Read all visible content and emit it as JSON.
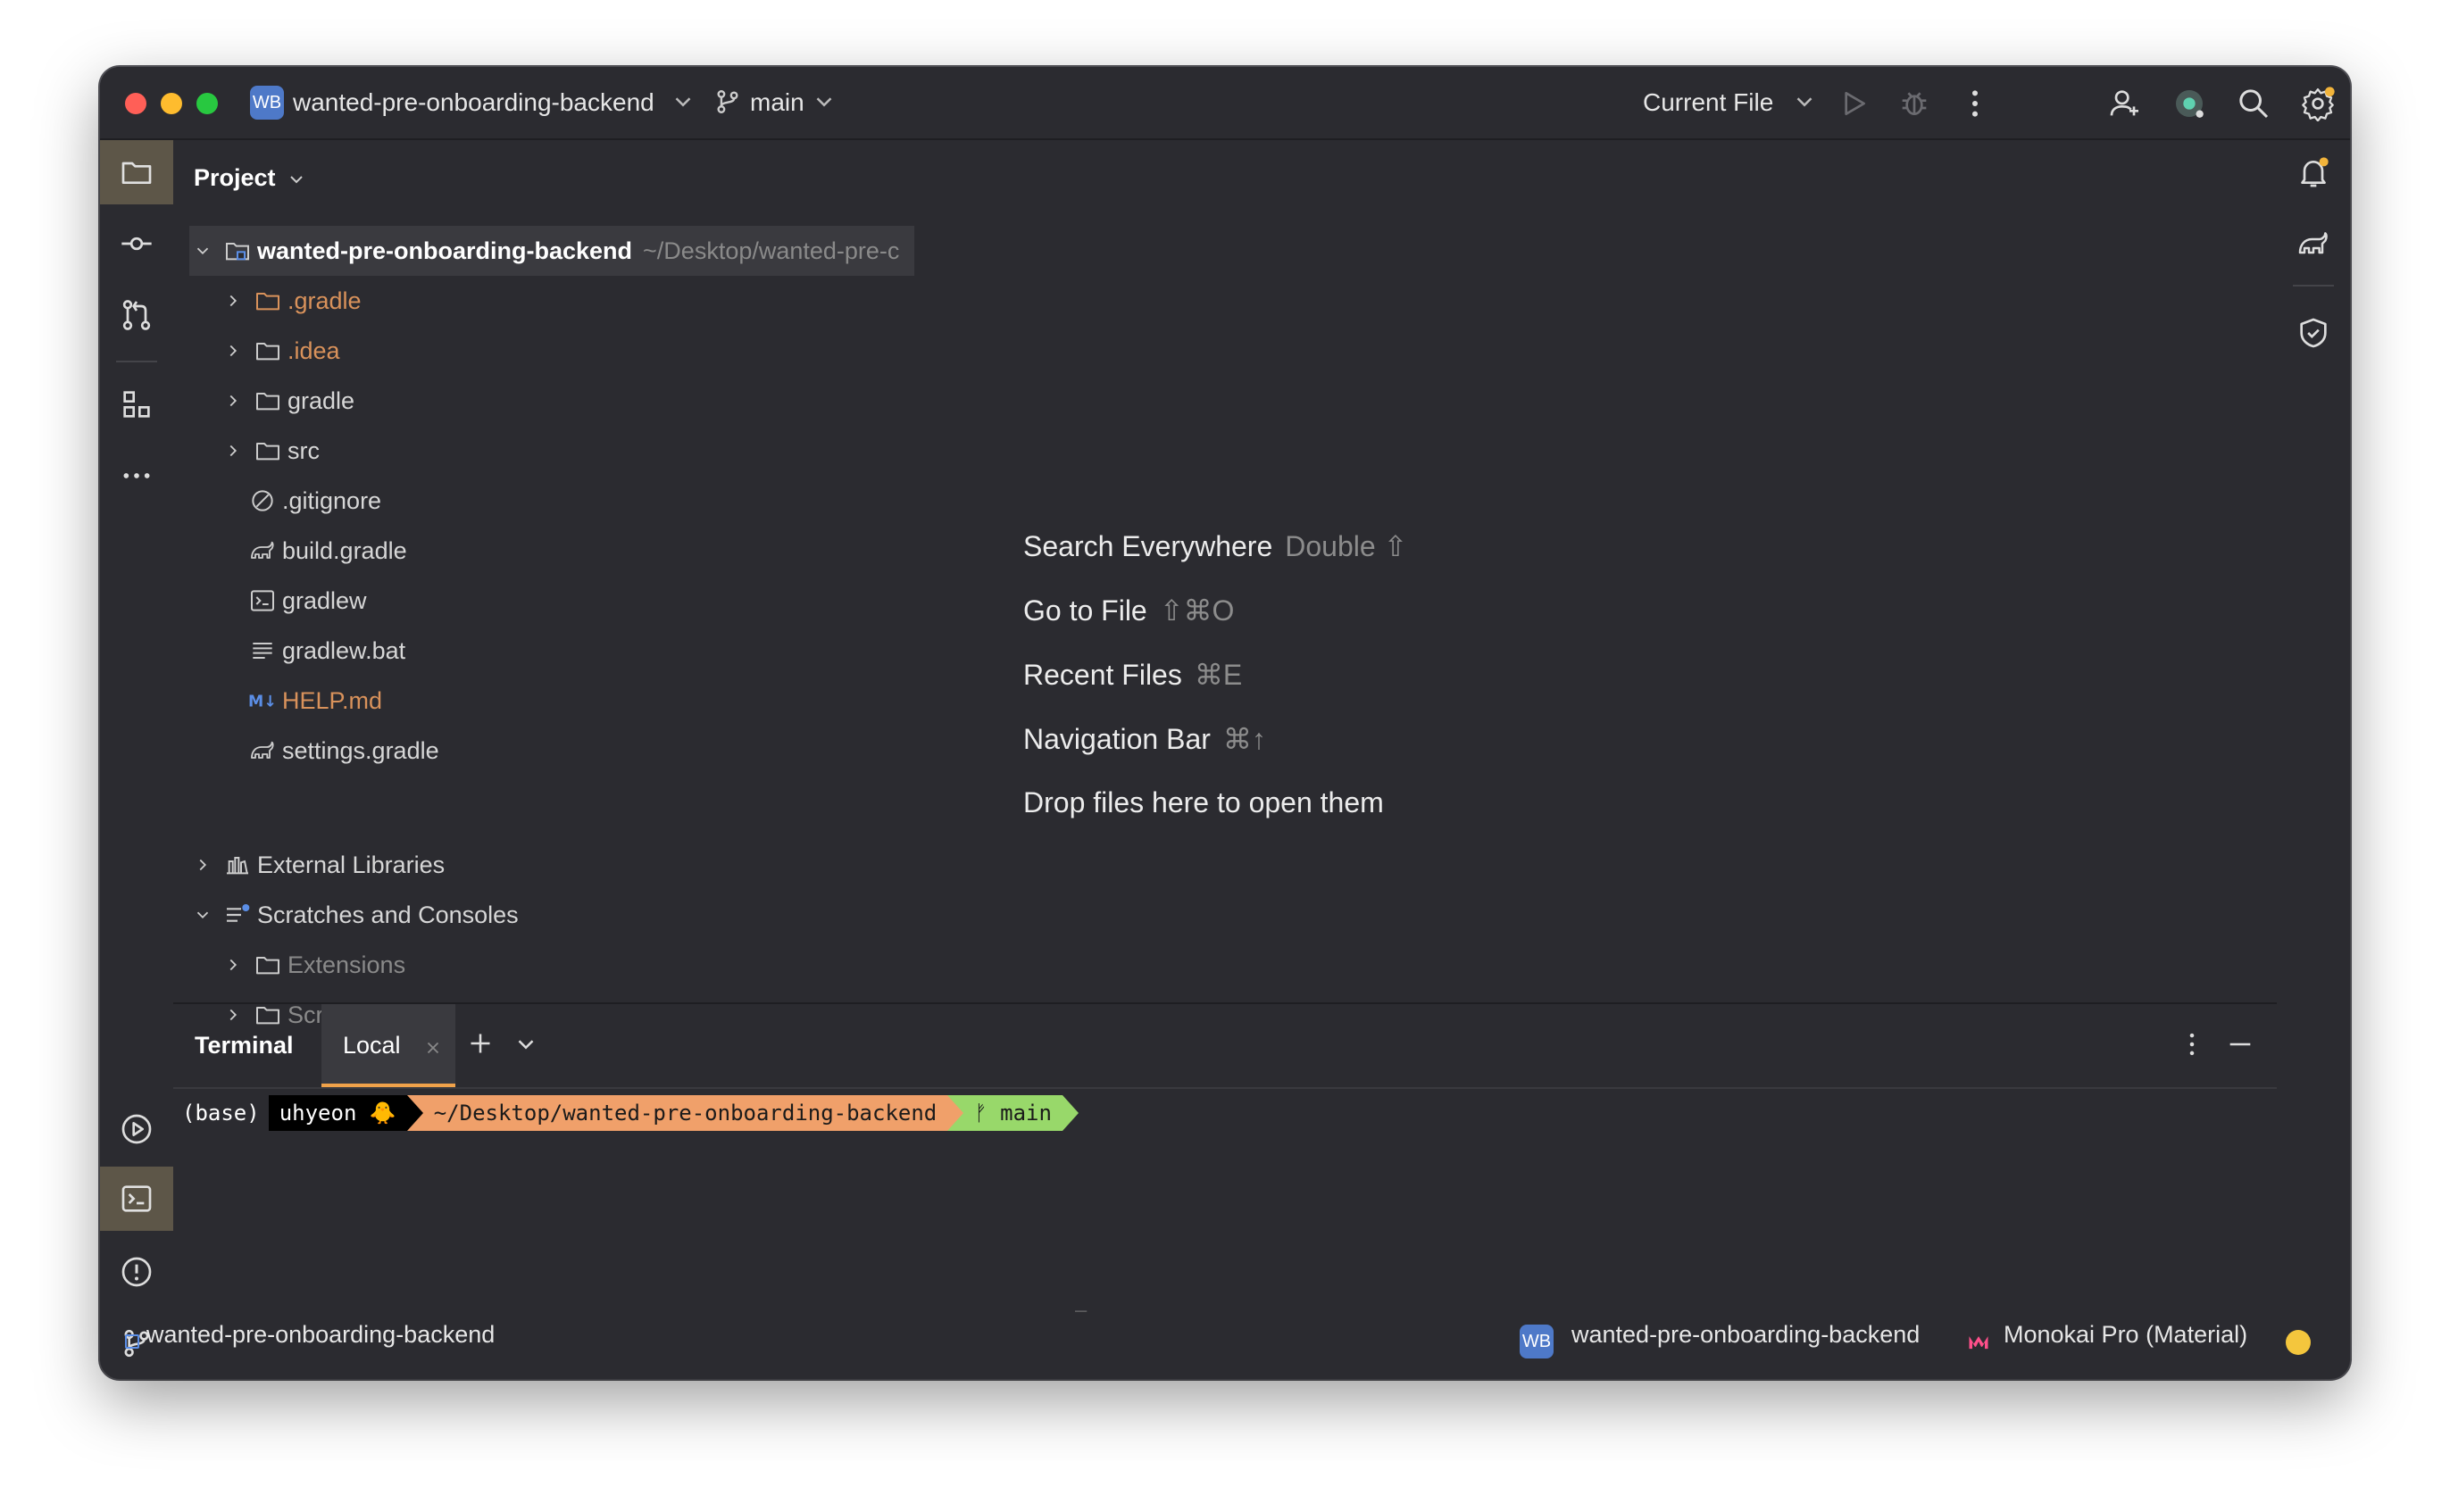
{
  "titlebar": {
    "project_badge": "WB",
    "project_name": "wanted-pre-onboarding-backend",
    "branch": "main",
    "run_config": "Current File"
  },
  "project_panel": {
    "title": "Project",
    "root": {
      "name": "wanted-pre-onboarding-backend",
      "path": "~/Desktop/wanted-pre-c"
    },
    "items": [
      {
        "label": ".gradle",
        "icon": "folder-icon"
      },
      {
        "label": ".idea",
        "icon": "folder-icon"
      },
      {
        "label": "gradle",
        "icon": "folder-icon"
      },
      {
        "label": "src",
        "icon": "folder-icon"
      },
      {
        "label": ".gitignore",
        "icon": "ignore-file-icon"
      },
      {
        "label": "build.gradle",
        "icon": "gradle-elephant-icon"
      },
      {
        "label": "gradlew",
        "icon": "shell-script-icon"
      },
      {
        "label": "gradlew.bat",
        "icon": "text-file-icon"
      },
      {
        "label": "HELP.md",
        "icon": "markdown-icon"
      },
      {
        "label": "settings.gradle",
        "icon": "gradle-elephant-icon"
      }
    ],
    "external_libraries": "External Libraries",
    "scratches": {
      "label": "Scratches and Consoles",
      "children": [
        "Extensions",
        "Scratches"
      ]
    }
  },
  "hints": {
    "search_everywhere": "Search Everywhere",
    "search_everywhere_sc": "Double ⇧",
    "go_to_file": "Go to File",
    "go_to_file_sc": "⇧⌘O",
    "recent_files": "Recent Files",
    "recent_files_sc": "⌘E",
    "navigation_bar": "Navigation Bar",
    "navigation_bar_sc": "⌘↑",
    "drop_files": "Drop files here to open them"
  },
  "terminal": {
    "title": "Terminal",
    "tab": "Local",
    "prompt": {
      "env": "(base)",
      "user": "uhyeon 🐥",
      "dir": "~/Desktop/wanted-pre-onboarding-backend",
      "git": "ᚠ main"
    },
    "cursor": "_"
  },
  "statusbar": {
    "project": "wanted-pre-onboarding-backend",
    "project_badge": "WB",
    "project_name": "wanted-pre-onboarding-backend",
    "theme": "Monokai Pro (Material)"
  },
  "colors": {
    "background": "#2b2b30",
    "accent_orange": "#f0a24a",
    "prompt_dir": "#f0a06a",
    "prompt_git": "#98d86a",
    "badge_blue": "#4e79c8"
  }
}
